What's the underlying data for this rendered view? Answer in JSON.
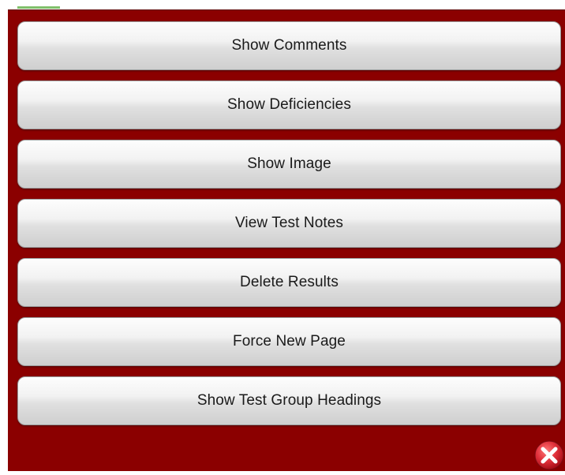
{
  "menu": {
    "items": [
      {
        "label": "Show Comments"
      },
      {
        "label": "Show Deficiencies"
      },
      {
        "label": "Show Image"
      },
      {
        "label": "View Test Notes"
      },
      {
        "label": "Delete Results"
      },
      {
        "label": "Force New Page"
      },
      {
        "label": "Show Test Group Headings"
      }
    ]
  },
  "close": {
    "icon": "close-icon"
  },
  "colors": {
    "panel_background": "#8b0000",
    "close_icon": "#e0303a"
  }
}
